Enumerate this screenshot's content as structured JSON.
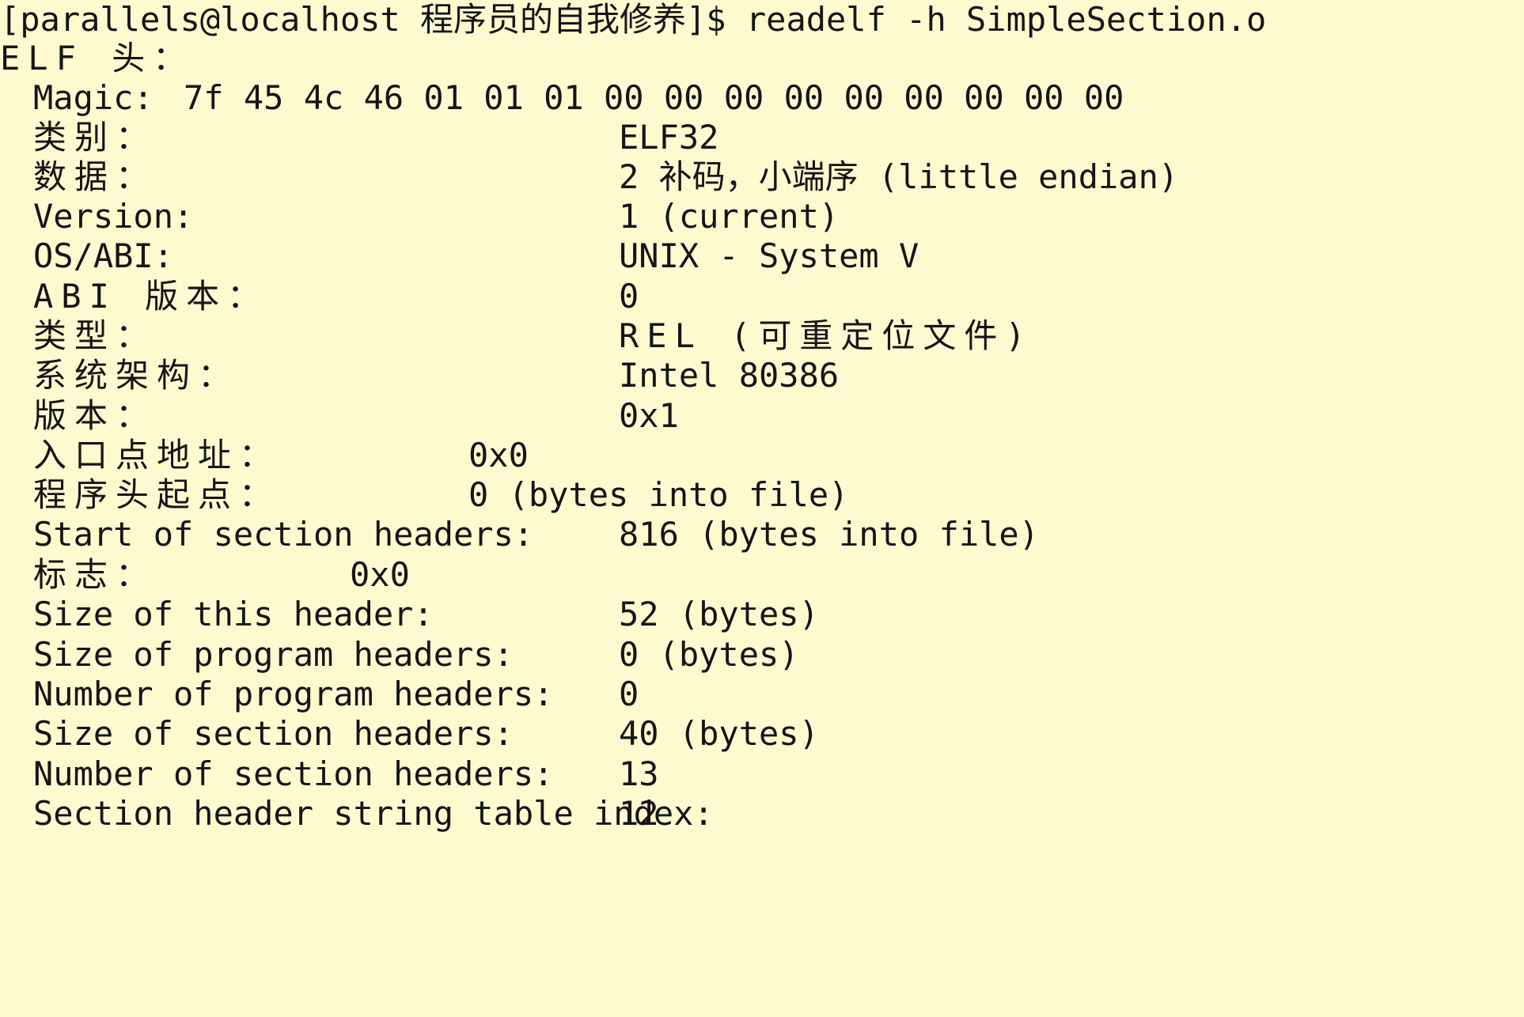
{
  "terminal": {
    "background": "#fdfad0",
    "text_color": "#151515",
    "prompt": "[parallels@localhost 程序员的自我修养]$ readelf -h SimpleSection.o",
    "elf_header_title": "ELF 头：",
    "magic": {
      "label": "Magic:",
      "value": "7f 45 4c 46 01 01 01 00 00 00 00 00 00 00 00 00"
    },
    "rows": [
      {
        "label": "类别：",
        "value": "ELF32"
      },
      {
        "label": "数据：",
        "value": "2 补码，小端序 (little endian)"
      },
      {
        "label": "Version:",
        "value": "1 (current)"
      },
      {
        "label": "OS/ABI:",
        "value": "UNIX - System V"
      },
      {
        "label": "ABI 版本：",
        "value": "0"
      },
      {
        "label": "类型：",
        "value": "REL (可重定位文件)"
      },
      {
        "label": "系统架构：",
        "value": "Intel 80386"
      },
      {
        "label": "版本：",
        "value": "0x1"
      },
      {
        "label": "入口点地址：",
        "value": "0x0"
      },
      {
        "label": "程序头起点：",
        "value": "0 (bytes into file)"
      },
      {
        "label": "Start of section headers:",
        "value": "816 (bytes into file)"
      },
      {
        "label": "标志：",
        "value": "0x0"
      },
      {
        "label": "Size of this header:",
        "value": "52 (bytes)"
      },
      {
        "label": "Size of program headers:",
        "value": "0 (bytes)"
      },
      {
        "label": "Number of program headers:",
        "value": "0"
      },
      {
        "label": "Size of section headers:",
        "value": "40 (bytes)"
      },
      {
        "label": "Number of section headers:",
        "value": "13"
      },
      {
        "label": "Section header string table index:",
        "value": "12"
      }
    ]
  }
}
